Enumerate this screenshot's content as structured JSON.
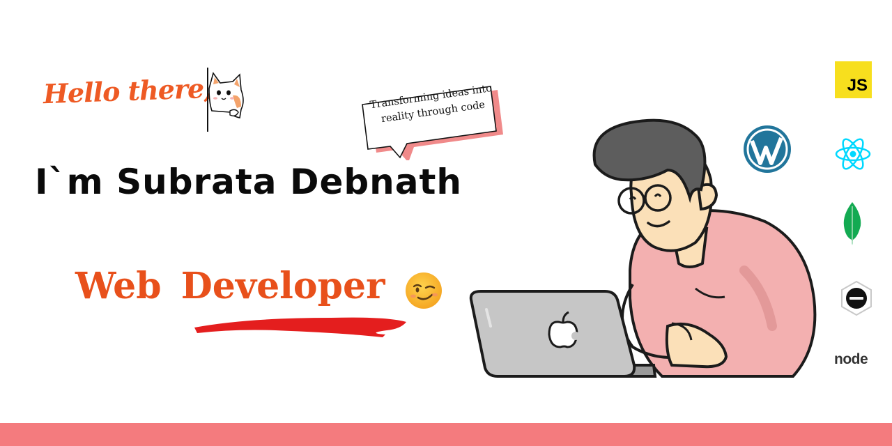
{
  "hero": {
    "greeting": "Hello there,",
    "speech_bubble_line1": "Transforming ideas into",
    "speech_bubble_line2": "reality through code",
    "name": "I`m Subrata Debnath",
    "role": "Web Developer",
    "role_emoji": "winking-face"
  },
  "illustration": {
    "subject": "developer-at-laptop",
    "laptop_logo": "apple-logo"
  },
  "tech_icons": [
    {
      "name": "javascript",
      "label": "JS",
      "color": "#f7df1e"
    },
    {
      "name": "wordpress",
      "color": "#21759b"
    },
    {
      "name": "react",
      "color": "#61dafb"
    },
    {
      "name": "mongodb",
      "color": "#47a248"
    },
    {
      "name": "express",
      "color": "#000000"
    },
    {
      "name": "nodejs",
      "label": "node",
      "color": "#333333"
    }
  ],
  "colors": {
    "accent": "#e8501b",
    "bottom_bar": "#f47b7e",
    "sweater": "#f3b0b0"
  }
}
